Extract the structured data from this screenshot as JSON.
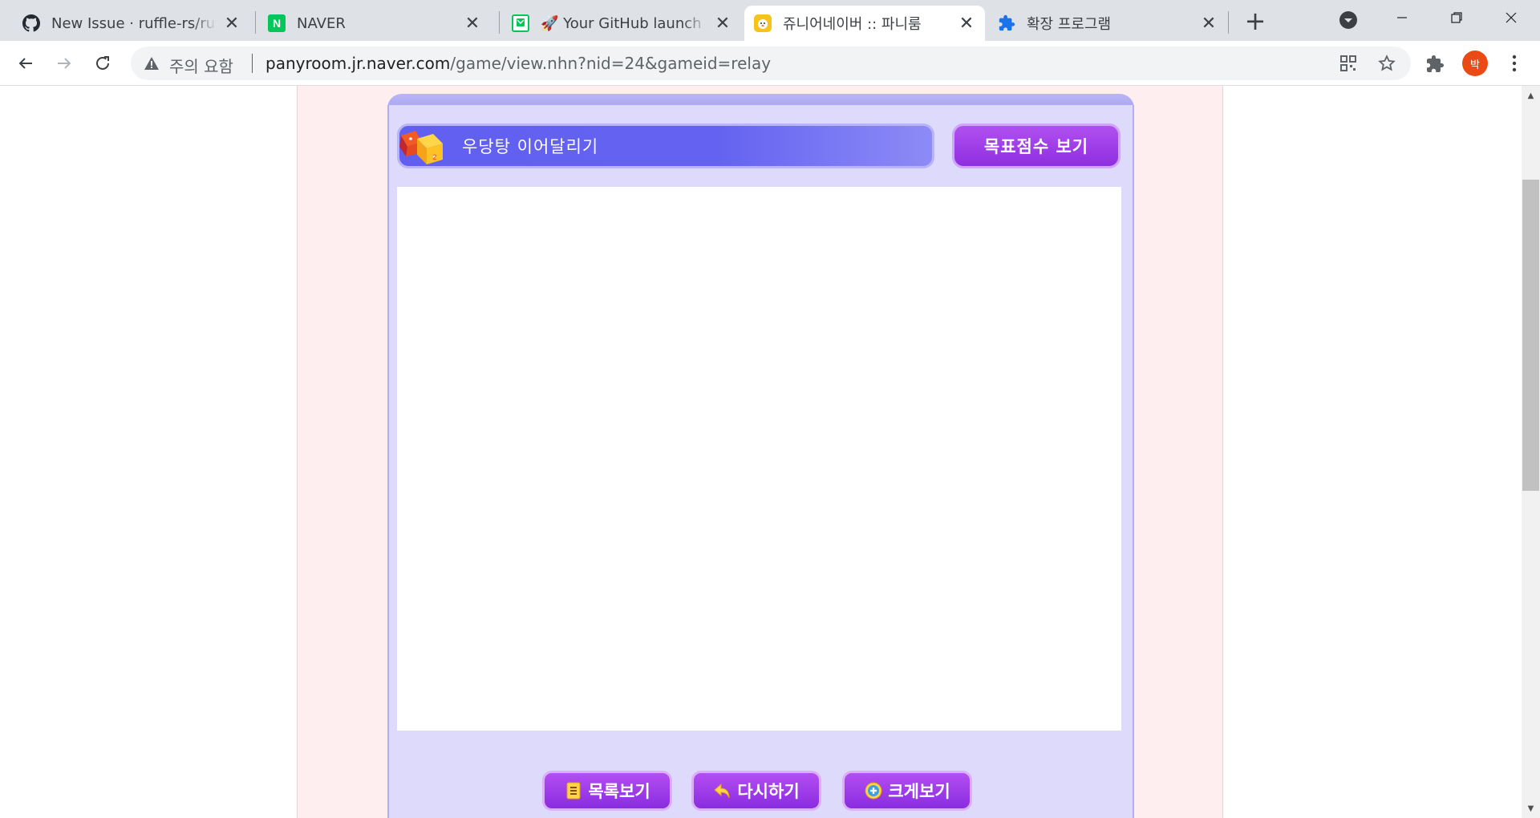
{
  "browser": {
    "tabs": [
      {
        "title": "New Issue · ruffle-rs/ruffle",
        "favicon": "github-icon"
      },
      {
        "title": "NAVER",
        "favicon": "naver-icon"
      },
      {
        "title": "🚀 Your GitHub launch code",
        "favicon": "naver-mail-icon"
      },
      {
        "title": "쥬니어네이버 :: 파니룸",
        "favicon": "junior-naver-icon",
        "active": true
      },
      {
        "title": "확장 프로그램",
        "favicon": "puzzle-icon"
      }
    ],
    "address": {
      "security_label": "주의 요함",
      "url_host": "panyroom.jr.naver.com",
      "url_rest": "/game/view.nhn?nid=24&gameid=relay"
    },
    "profile_initial": "박"
  },
  "game": {
    "title": "우당탕 이어달리기",
    "goal_button": "목표점수 보기",
    "buttons": {
      "list": "목록보기",
      "retry": "다시하기",
      "enlarge": "크게보기"
    }
  },
  "colors": {
    "page_bg": "#ffeef0",
    "frame_bg": "#dddafb",
    "title_bar": "#6463f1",
    "button_purple": "#9a38e6",
    "profile": "#ea4a15"
  }
}
